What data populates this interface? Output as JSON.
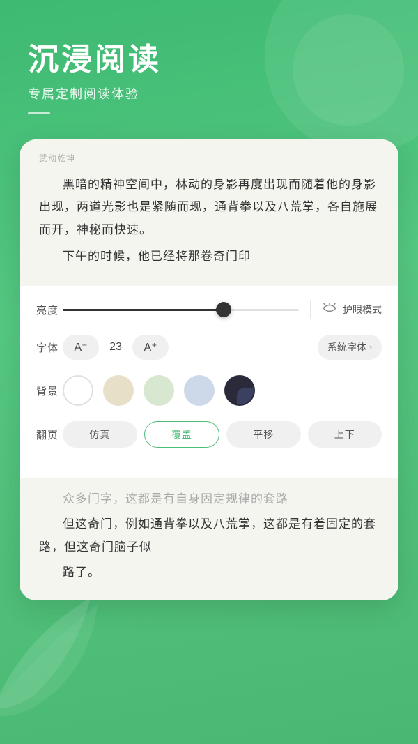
{
  "header": {
    "title": "沉浸阅读",
    "subtitle": "专属定制阅读体验"
  },
  "reading": {
    "book_title": "武动乾坤",
    "paragraph1": "黑暗的精神空间中，林动的身影再度出现而随着他的身影出现，两道光影也是紧随而现，通背拳以及八荒掌，各自施展而开，神秘而快速。",
    "paragraph2_partial": "下午的时候，他已经将那卷奇门印"
  },
  "settings": {
    "brightness_label": "亮度",
    "brightness_value": 68,
    "eye_mode_label": "护眼模式",
    "font_label": "字体",
    "font_decrease": "A⁻",
    "font_size": "23",
    "font_increase": "A⁺",
    "font_family": "系统字体",
    "background_label": "背景",
    "backgrounds": [
      {
        "id": "white",
        "label": "白色",
        "selected": false
      },
      {
        "id": "cream",
        "label": "米色",
        "selected": false
      },
      {
        "id": "mint",
        "label": "绿色",
        "selected": false
      },
      {
        "id": "lavender",
        "label": "蓝色",
        "selected": false
      },
      {
        "id": "dark",
        "label": "黑暗",
        "selected": false
      }
    ],
    "pageturn_label": "翻页",
    "pageturn_options": [
      {
        "id": "simulation",
        "label": "仿真",
        "active": false
      },
      {
        "id": "cover",
        "label": "覆盖",
        "active": true
      },
      {
        "id": "slide",
        "label": "平移",
        "active": false
      },
      {
        "id": "vertical",
        "label": "上下",
        "active": false
      }
    ]
  },
  "bottom_reading": {
    "blur_text": "众多门字，这都是有自身固定规律的套路",
    "paragraph1": "但这奇门，例如通背拳以及八荒掌，这都是有着固定的套路，但这奇门脑子似",
    "paragraph2_partial": "路了。"
  }
}
